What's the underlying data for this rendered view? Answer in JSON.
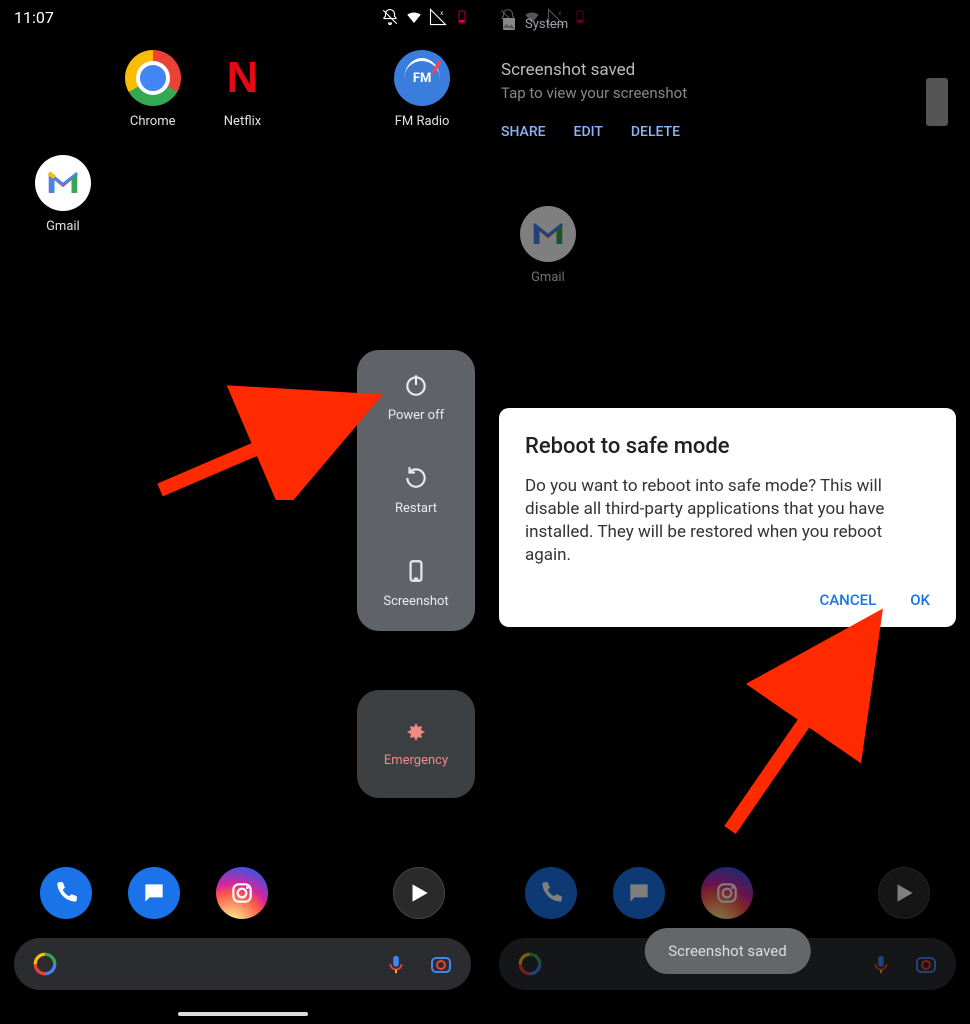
{
  "left": {
    "statusbar": {
      "time": "11:07"
    },
    "apps": {
      "chrome": "Chrome",
      "netflix": "Netflix",
      "netflix_glyph": "N",
      "fmradio": "FM Radio",
      "fm_glyph": "FM",
      "gmail": "Gmail"
    },
    "power_menu": {
      "power_off": "Power off",
      "restart": "Restart",
      "screenshot": "Screenshot",
      "emergency": "Emergency"
    }
  },
  "right": {
    "notification": {
      "app": "System",
      "title": "Screenshot saved",
      "subtitle": "Tap to view your screenshot",
      "actions": {
        "share": "SHARE",
        "edit": "EDIT",
        "delete": "DELETE"
      }
    },
    "apps": {
      "gmail": "Gmail"
    },
    "dialog": {
      "title": "Reboot to safe mode",
      "body": "Do you want to reboot into safe mode? This will disable all third-party applications that you have installed. They will be restored when you reboot again.",
      "cancel": "CANCEL",
      "ok": "OK"
    },
    "toast": "Screenshot saved"
  }
}
